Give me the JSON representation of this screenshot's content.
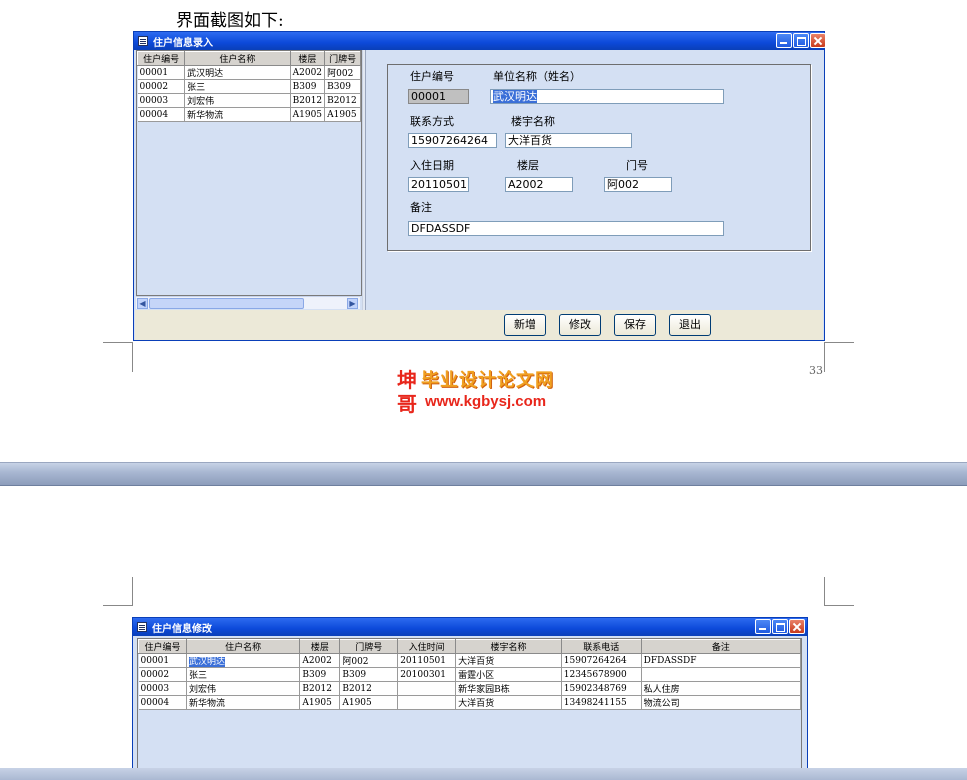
{
  "caption": "界面截图如下:",
  "window1": {
    "title": "住户信息录入",
    "grid": {
      "headers": [
        "住户编号",
        "住户名称",
        "楼层",
        "门牌号"
      ],
      "rows": [
        [
          "00001",
          "武汉明达",
          "A2002",
          "阿002"
        ],
        [
          "00002",
          "张三",
          "B309",
          "B309"
        ],
        [
          "00003",
          "刘宏伟",
          "B2012",
          "B2012"
        ],
        [
          "00004",
          "新华物流",
          "A1905",
          "A1905"
        ]
      ]
    },
    "form": {
      "labels": {
        "resident_no": "住户编号",
        "unit_name": "单位名称（姓名）",
        "contact": "联系方式",
        "building_name": "楼宇名称",
        "checkin_date": "入住日期",
        "floor": "楼层",
        "door_no": "门号",
        "remark": "备注"
      },
      "values": {
        "resident_no": "00001",
        "unit_name": "武汉明达",
        "contact": "15907264264",
        "building_name": "大洋百货",
        "checkin_date": "20110501",
        "floor": "A2002",
        "door_no": "阿002",
        "remark": "DFDASSDF"
      }
    },
    "buttons": {
      "add": "新增",
      "edit": "修改",
      "save": "保存",
      "exit": "退出"
    }
  },
  "page_number": "33",
  "watermark": {
    "char1": "坤",
    "char2": "哥",
    "site_name": "毕业设计论文网",
    "url": "www.kgbysj.com"
  },
  "window2": {
    "title": "住户信息修改",
    "grid": {
      "headers": [
        "住户编号",
        "住户名称",
        "楼层",
        "门牌号",
        "入住时间",
        "楼宇名称",
        "联系电话",
        "备注"
      ],
      "rows": [
        [
          "00001",
          "武汉明达",
          "A2002",
          "阿002",
          "20110501",
          "大洋百货",
          "15907264264",
          "DFDASSDF"
        ],
        [
          "00002",
          "张三",
          "B309",
          "B309",
          "20100301",
          "雷霆小区",
          "12345678900",
          ""
        ],
        [
          "00003",
          "刘宏伟",
          "B2012",
          "B2012",
          "",
          "新华家园B栋",
          "15902348769",
          "私人住房"
        ],
        [
          "00004",
          "新华物流",
          "A1905",
          "A1905",
          "",
          "大洋百货",
          "13498241155",
          "物流公司"
        ]
      ]
    }
  },
  "colors": {
    "title_bar": "#0a3fb8",
    "window_bg": "#d4e0f3",
    "selection": "#3a6fd8",
    "watermark_red": "#e8261b",
    "watermark_orange": "#f0a020"
  }
}
